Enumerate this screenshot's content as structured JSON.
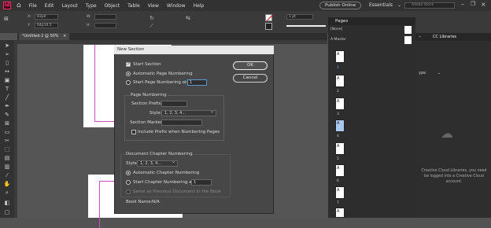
{
  "menubar": {
    "app_icon": "Id",
    "home_icon": "home-icon",
    "items": [
      "File",
      "Edit",
      "Layout",
      "Type",
      "Object",
      "Table",
      "View",
      "Window",
      "Help"
    ],
    "publish_label": "Publish Online",
    "workspace_label": "Essentials",
    "search_placeholder": "Adobe Stock"
  },
  "control_bar": {
    "x_label": "X:",
    "x_value": "83p0",
    "y_label": "Y:",
    "y_value": "64p10.5",
    "w_label": "W:",
    "h_label": "H:",
    "stroke_weight": "1 pt",
    "zoom": "100%"
  },
  "doc_tab": {
    "label": "*Untitled-2 @ 50%",
    "close": "×"
  },
  "pages_panel": {
    "title": "Pages",
    "none_label": "[None]",
    "master_label": "A-Master",
    "pages": [
      "1",
      "2",
      "3",
      "4",
      "5",
      "6",
      "7",
      "8"
    ],
    "selected": [
      1,
      4
    ],
    "marker": "A"
  },
  "cc_libraries": {
    "title": "CC Libraries",
    "type_label": "ype",
    "message": "Creative Cloud Libraries, you need be logged into a Creative Cloud account."
  },
  "dialog": {
    "title": "New Section",
    "start_section": "Start Section",
    "auto_numbering": "Automatic Page Numbering",
    "start_numbering_at": "Start Page Numbering at:",
    "start_value": "1",
    "page_numbering_heading": "Page Numbering",
    "section_prefix_label": "Section Prefix:",
    "section_prefix_value": "",
    "style_label": "Style:",
    "style_value": "1, 2, 3, 4...",
    "section_marker_label": "Section Marker:",
    "section_marker_value": "",
    "include_prefix": "Include Prefix when Numbering Pages",
    "chapter_heading": "Document Chapter Numbering",
    "chapter_style_label": "Style:",
    "chapter_style_value": "1, 2, 3, 4...",
    "auto_chapter": "Automatic Chapter Numbering",
    "start_chapter_at": "Start Chapter Numbering at:",
    "chapter_value": "1",
    "same_as_previous": "Same as Previous Document in the Book",
    "book_name_label": "Book Name:",
    "book_name_value": "N/A",
    "ok_label": "OK",
    "cancel_label": "Cancel"
  }
}
